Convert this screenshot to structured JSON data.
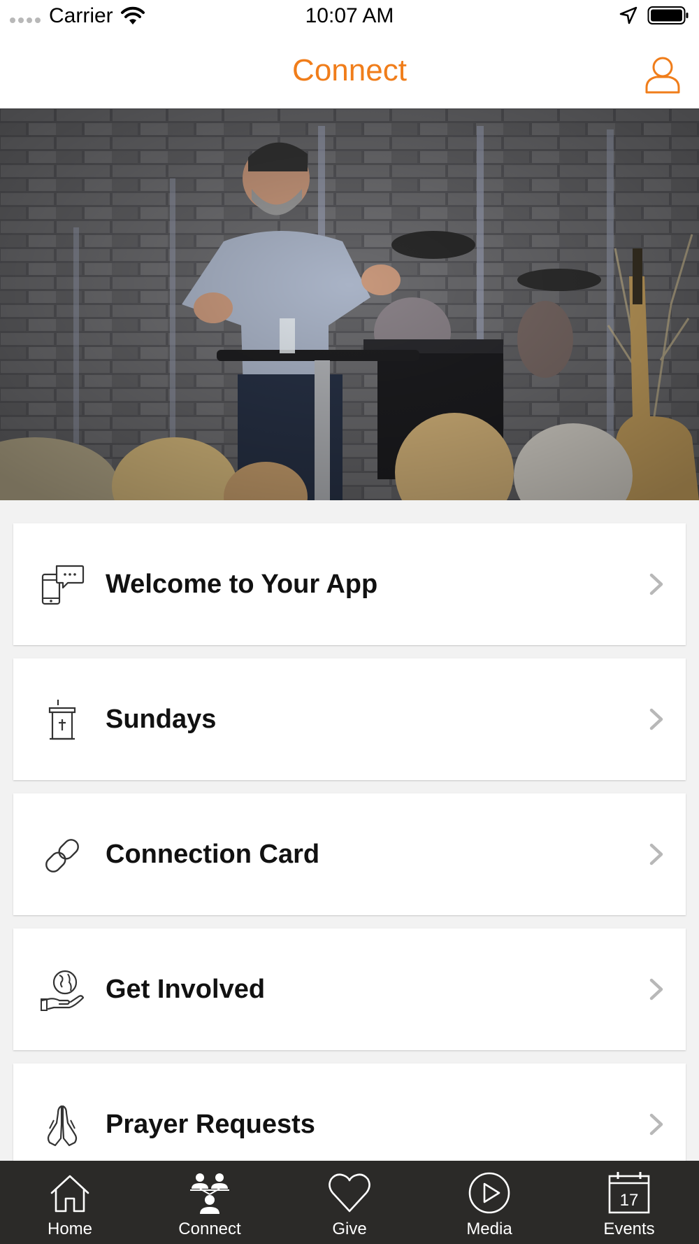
{
  "status_bar": {
    "carrier": "Carrier",
    "time": "10:07 AM"
  },
  "header": {
    "title": "Connect",
    "accent_color": "#f07d1a",
    "profile_icon": "person-icon"
  },
  "hero": {
    "icon": "photo-speaker-on-stage"
  },
  "items": [
    {
      "label": "Welcome to Your App",
      "icon": "phone-chat-icon"
    },
    {
      "label": "Sundays",
      "icon": "pulpit-icon"
    },
    {
      "label": "Connection Card",
      "icon": "link-icon"
    },
    {
      "label": "Get Involved",
      "icon": "globe-hand-icon"
    },
    {
      "label": "Prayer Requests",
      "icon": "praying-hands-icon"
    }
  ],
  "tabs": [
    {
      "label": "Home",
      "icon": "home-icon"
    },
    {
      "label": "Connect",
      "icon": "people-icon",
      "active": true
    },
    {
      "label": "Give",
      "icon": "heart-icon"
    },
    {
      "label": "Media",
      "icon": "play-icon"
    },
    {
      "label": "Events",
      "icon": "calendar-icon",
      "day": "17"
    }
  ]
}
